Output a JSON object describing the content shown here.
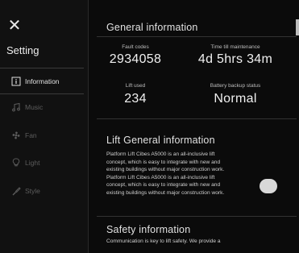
{
  "sidebar": {
    "title": "Setting",
    "items": [
      {
        "label": "Information",
        "icon": "info-icon",
        "active": true
      },
      {
        "label": "Music",
        "icon": "music-icon",
        "active": false
      },
      {
        "label": "Fan",
        "icon": "fan-icon",
        "active": false
      },
      {
        "label": "Light",
        "icon": "light-icon",
        "active": false
      },
      {
        "label": "Style",
        "icon": "style-icon",
        "active": false
      }
    ]
  },
  "general": {
    "title": "General information",
    "stats": [
      {
        "label": "Fault codes",
        "value": "2934058"
      },
      {
        "label": "Time till maintenance",
        "value": "4d 5hrs 34m"
      },
      {
        "label": "Lift used",
        "value": "234"
      },
      {
        "label": "Battery backup status",
        "value": "Normal"
      }
    ]
  },
  "lift_general": {
    "title": "Lift General information",
    "lines": [
      "Platform Lift Cibes A5000 is an all-inclusive lift",
      "concept, which is easy to integrate with new and",
      "existing buildings without major construction work.",
      "Platform Lift Cibes A5000 is an all-inclusive lift",
      "concept, which is easy to integrate with new and",
      "existing buildings without major construction work."
    ]
  },
  "safety": {
    "title": "Safety information",
    "text": "Communication is key to lift safety. We provide a"
  },
  "colors": {
    "background": "#0d0d0d",
    "text": "#e6e6e6",
    "muted": "#5d5d5d"
  }
}
